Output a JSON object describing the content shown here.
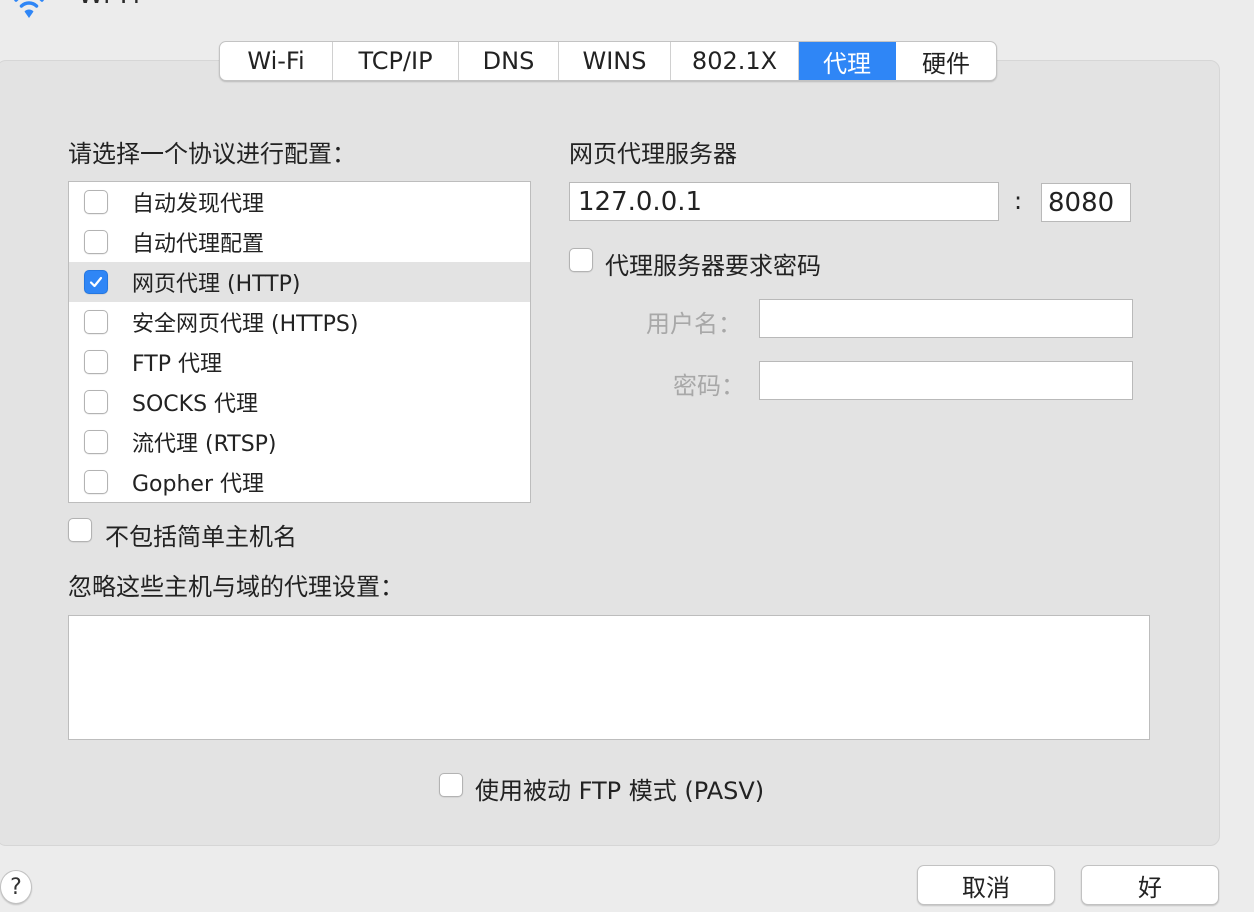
{
  "window": {
    "title": "Wi-Fi"
  },
  "tabs": [
    {
      "label": "Wi-Fi",
      "active": false
    },
    {
      "label": "TCP/IP",
      "active": false
    },
    {
      "label": "DNS",
      "active": false
    },
    {
      "label": "WINS",
      "active": false
    },
    {
      "label": "802.1X",
      "active": false
    },
    {
      "label": "代理",
      "active": true
    },
    {
      "label": "硬件",
      "active": false
    }
  ],
  "protocols": {
    "heading": "请选择一个协议进行配置：",
    "items": [
      {
        "label": "自动发现代理",
        "checked": false
      },
      {
        "label": "自动代理配置",
        "checked": false
      },
      {
        "label": "网页代理 (HTTP)",
        "checked": true,
        "selected": true
      },
      {
        "label": "安全网页代理 (HTTPS)",
        "checked": false
      },
      {
        "label": "FTP 代理",
        "checked": false
      },
      {
        "label": "SOCKS 代理",
        "checked": false
      },
      {
        "label": "流代理 (RTSP)",
        "checked": false
      },
      {
        "label": "Gopher 代理",
        "checked": false
      }
    ]
  },
  "server": {
    "heading": "网页代理服务器",
    "address": "127.0.0.1",
    "separator": ":",
    "port": "8080",
    "require_password": {
      "label": "代理服务器要求密码",
      "checked": false
    },
    "username_label": "用户名：",
    "username": "",
    "password_label": "密码：",
    "password": ""
  },
  "exclude_simple": {
    "label": "不包括简单主机名",
    "checked": false
  },
  "bypass": {
    "heading": "忽略这些主机与域的代理设置：",
    "value": ""
  },
  "pasv": {
    "label": "使用被动 FTP 模式 (PASV)",
    "checked": false
  },
  "buttons": {
    "help": "?",
    "cancel": "取消",
    "ok": "好"
  },
  "colors": {
    "accent": "#2f86f6",
    "background": "#ececec",
    "panel": "#e3e3e3"
  }
}
